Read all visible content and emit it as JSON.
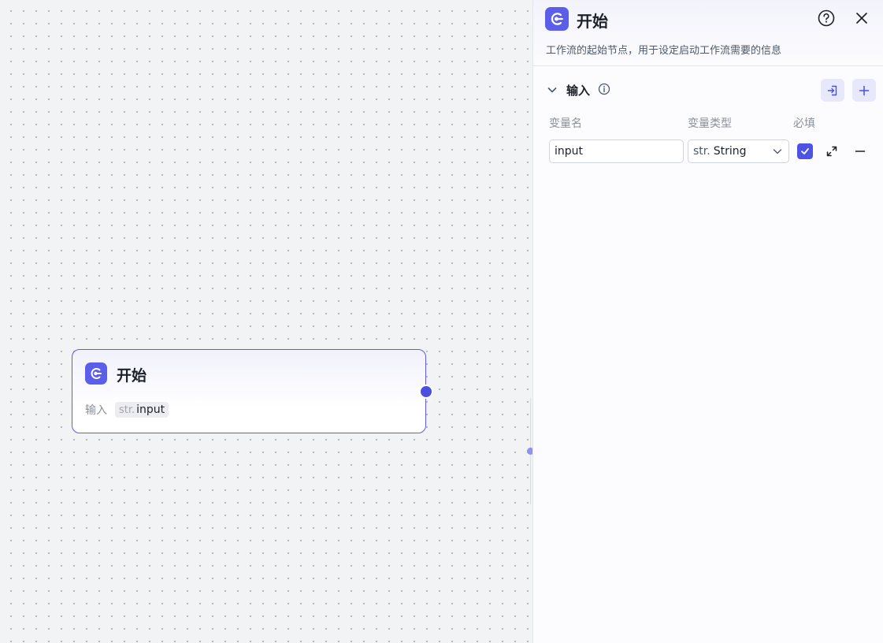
{
  "canvas": {
    "node": {
      "title": "开始",
      "icon": "start-node-icon",
      "input_label": "输入",
      "input_tag_type": "str.",
      "input_tag_name": "input",
      "accent": "#5a5ee8"
    }
  },
  "panel": {
    "title": "开始",
    "description": "工作流的起始节点，用于设定启动工作流需要的信息",
    "help_icon": "help-circle-icon",
    "close_icon": "close-icon",
    "section": {
      "title": "输入",
      "info_icon": "info-icon",
      "import_icon": "import-icon",
      "add_icon": "plus-icon"
    },
    "columns": {
      "name": "变量名",
      "type": "变量类型",
      "required": "必填"
    },
    "rows": [
      {
        "name_value": "input",
        "type_prefix": "str.",
        "type_value": "String",
        "required": true
      }
    ]
  },
  "colors": {
    "accent": "#5a5ee8",
    "checkbox": "#4e52e5",
    "button_bg": "#e7e8fb"
  }
}
